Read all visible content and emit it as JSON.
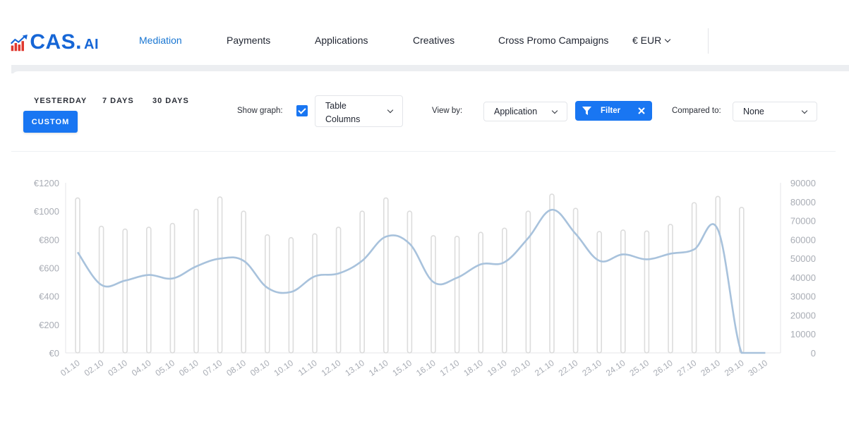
{
  "header": {
    "logo": {
      "main": "CAS.",
      "suffix": "AI"
    },
    "nav": [
      {
        "label": "Mediation",
        "active": true
      },
      {
        "label": "Payments",
        "active": false
      },
      {
        "label": "Applications",
        "active": false
      },
      {
        "label": "Creatives",
        "active": false
      },
      {
        "label": "Cross Promo Campaigns",
        "active": false
      }
    ],
    "currency": "€ EUR"
  },
  "toolbar": {
    "ranges": [
      "YESTERDAY",
      "7 DAYS",
      "30 DAYS"
    ],
    "custom_label": "CUSTOM",
    "show_graph_label": "Show graph:",
    "show_graph_checked": true,
    "table_columns": "Table Columns",
    "view_by_label": "View by:",
    "view_by_value": "Application",
    "filter_label": "Filter",
    "compared_to_label": "Compared to:",
    "compared_to_value": "None"
  },
  "colors": {
    "accent": "#1976f2",
    "active_nav": "#1976d2",
    "line": "#a8c2dc",
    "bar_stroke": "#dcdcdc"
  },
  "chart_data": {
    "type": "bar",
    "title": "",
    "categories": [
      "01.10",
      "02.10",
      "03.10",
      "04.10",
      "05.10",
      "06.10",
      "07.10",
      "08.10",
      "09.10",
      "10.10",
      "11.10",
      "12.10",
      "13.10",
      "14.10",
      "15.10",
      "16.10",
      "17.10",
      "18.10",
      "19.10",
      "20.10",
      "21.10",
      "22.10",
      "23.10",
      "24.10",
      "25.10",
      "26.10",
      "27.10",
      "28.10",
      "29.10",
      "30.10"
    ],
    "y_left": {
      "ticks": [
        "€0",
        "€200",
        "€400",
        "€600",
        "€800",
        "€1000",
        "€1200"
      ],
      "range": [
        0,
        1200
      ]
    },
    "y_right": {
      "ticks": [
        "0",
        "10000",
        "20000",
        "30000",
        "40000",
        "50000",
        "60000",
        "70000",
        "80000",
        "90000"
      ],
      "range": [
        0,
        90000
      ]
    },
    "series": [
      {
        "type": "bar",
        "axis": "right",
        "values": [
          82000,
          67000,
          65500,
          66500,
          68500,
          76000,
          82500,
          75000,
          62500,
          61000,
          63000,
          66500,
          75000,
          82000,
          75000,
          62000,
          61700,
          63800,
          66000,
          75000,
          84000,
          76500,
          64200,
          65000,
          64500,
          68000,
          79500,
          82800,
          77000,
          0
        ]
      },
      {
        "type": "line",
        "axis": "left",
        "values": [
          710,
          480,
          510,
          550,
          525,
          610,
          665,
          650,
          460,
          430,
          540,
          560,
          650,
          820,
          770,
          500,
          530,
          625,
          640,
          810,
          1010,
          840,
          650,
          695,
          660,
          700,
          730,
          870,
          0,
          0
        ]
      }
    ],
    "grid": false,
    "legend": "none"
  }
}
